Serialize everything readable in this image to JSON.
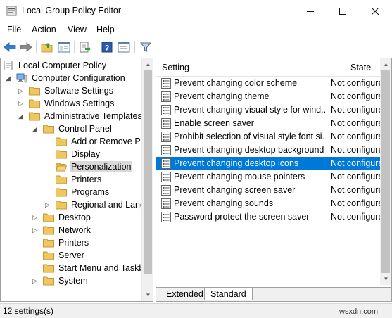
{
  "window": {
    "title": "Local Group Policy Editor"
  },
  "menu": [
    "File",
    "Action",
    "View",
    "Help"
  ],
  "toolbar": {
    "icons": [
      "back-arrow-icon",
      "forward-arrow-icon",
      "up-folder-icon",
      "show-hide-tree-icon",
      "export-list-icon",
      "help-icon",
      "properties-icon",
      "filter-icon"
    ]
  },
  "tree": {
    "items": [
      {
        "label": "Local Computer Policy"
      },
      {
        "label": "Computer Configuration"
      },
      {
        "label": "Software Settings"
      },
      {
        "label": "Windows Settings"
      },
      {
        "label": "Administrative Templates"
      },
      {
        "label": "Control Panel"
      },
      {
        "label": "Add or Remove Pr"
      },
      {
        "label": "Display"
      },
      {
        "label": "Personalization"
      },
      {
        "label": "Printers"
      },
      {
        "label": "Programs"
      },
      {
        "label": "Regional and Lang"
      },
      {
        "label": "Desktop"
      },
      {
        "label": "Network"
      },
      {
        "label": "Printers"
      },
      {
        "label": "Server"
      },
      {
        "label": "Start Menu and Taskb"
      },
      {
        "label": "System"
      }
    ],
    "selected": "Personalization"
  },
  "list": {
    "columns": {
      "setting": "Setting",
      "state": "State"
    },
    "rows": [
      {
        "setting": "Prevent changing color scheme",
        "state": "Not configured"
      },
      {
        "setting": "Prevent changing theme",
        "state": "Not configured"
      },
      {
        "setting": "Prevent changing visual style for wind...",
        "state": "Not configured"
      },
      {
        "setting": "Enable screen saver",
        "state": "Not configured"
      },
      {
        "setting": "Prohibit selection of visual style font si...",
        "state": "Not configured"
      },
      {
        "setting": "Prevent changing desktop background",
        "state": "Not configured"
      },
      {
        "setting": "Prevent changing desktop icons",
        "state": "Not configured"
      },
      {
        "setting": "Prevent changing mouse pointers",
        "state": "Not configured"
      },
      {
        "setting": "Prevent changing screen saver",
        "state": "Not configured"
      },
      {
        "setting": "Prevent changing sounds",
        "state": "Not configured"
      },
      {
        "setting": "Password protect the screen saver",
        "state": "Not configured"
      }
    ],
    "selected_index": 6
  },
  "tabs": [
    "Extended",
    "Standard"
  ],
  "active_tab": "Standard",
  "status": {
    "text": "12 settings(s)",
    "watermark": "wsxdn.com"
  },
  "colors": {
    "selection": "#0078d7",
    "folder": "#f0c75e"
  }
}
